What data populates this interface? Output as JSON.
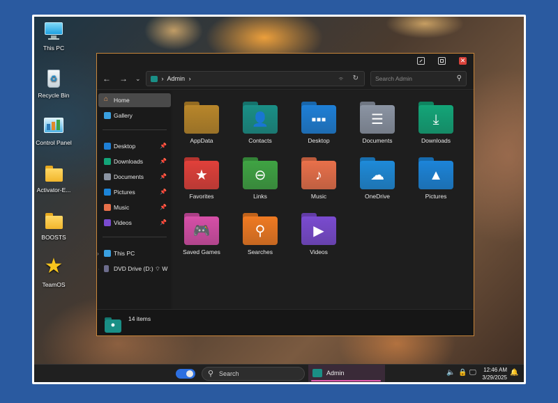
{
  "desktop_icons": [
    {
      "name": "this-pc-icon",
      "label": "This PC"
    },
    {
      "name": "recycle-bin-icon",
      "label": "Recycle Bin"
    },
    {
      "name": "control-panel-icon",
      "label": "Control Panel"
    },
    {
      "name": "folder-icon",
      "label": "Activator-E..."
    },
    {
      "name": "folder-icon",
      "label": "BOOSTS"
    },
    {
      "name": "star-icon",
      "label": "TeamOS"
    }
  ],
  "explorer": {
    "path_label": "Admin",
    "search_placeholder": "Search Admin",
    "sidebar": {
      "top": [
        {
          "icon": "home-icon",
          "label": "Home",
          "active": true
        },
        {
          "icon": "gallery-icon",
          "label": "Gallery",
          "active": false
        }
      ],
      "pinned": [
        {
          "icon": "desktop-icon",
          "label": "Desktop"
        },
        {
          "icon": "downloads-icon",
          "label": "Downloads"
        },
        {
          "icon": "documents-icon",
          "label": "Documents"
        },
        {
          "icon": "pictures-icon",
          "label": "Pictures"
        },
        {
          "icon": "music-icon",
          "label": "Music"
        },
        {
          "icon": "videos-icon",
          "label": "Videos"
        }
      ],
      "drives": [
        {
          "icon": "computer-icon",
          "label": "This PC"
        },
        {
          "icon": "dvd-drive-icon",
          "label": "DVD Drive (D:) ⌔ W"
        }
      ]
    },
    "folders": [
      {
        "label": "AppData",
        "color": "#b8862a",
        "icon": "appdata-folder-icon",
        "symbol": ""
      },
      {
        "label": "Contacts",
        "color": "#1a8f86",
        "icon": "contacts-folder-icon",
        "symbol": "👤"
      },
      {
        "label": "Desktop",
        "color": "#1e7fd6",
        "icon": "desktop-folder-icon",
        "symbol": "▪▪▪"
      },
      {
        "label": "Documents",
        "color": "#8b94a3",
        "icon": "documents-folder-icon",
        "symbol": "☰"
      },
      {
        "label": "Downloads",
        "color": "#13a578",
        "icon": "downloads-folder-icon",
        "symbol": "⤓"
      },
      {
        "label": "Favorites",
        "color": "#e0403a",
        "icon": "favorites-folder-icon",
        "symbol": "★"
      },
      {
        "label": "Links",
        "color": "#3fa343",
        "icon": "links-folder-icon",
        "symbol": "⊖"
      },
      {
        "label": "Music",
        "color": "#e8704a",
        "icon": "music-folder-icon",
        "symbol": "♪"
      },
      {
        "label": "OneDrive",
        "color": "#1e8ad8",
        "icon": "onedrive-folder-icon",
        "symbol": "☁"
      },
      {
        "label": "Pictures",
        "color": "#1c84d8",
        "icon": "pictures-folder-icon",
        "symbol": "▲"
      },
      {
        "label": "Saved Games",
        "color": "#d64fa8",
        "icon": "saved-games-folder-icon",
        "symbol": "🎮"
      },
      {
        "label": "Searches",
        "color": "#ef7a22",
        "icon": "searches-folder-icon",
        "symbol": "⚲"
      },
      {
        "label": "Videos",
        "color": "#7a4bd0",
        "icon": "videos-folder-icon",
        "symbol": "▶"
      }
    ],
    "status": {
      "count": "14 items"
    }
  },
  "taskbar": {
    "search_label": "Search",
    "app_label": "Admin",
    "time": "12:46 AM",
    "date": "3/29/2025"
  }
}
